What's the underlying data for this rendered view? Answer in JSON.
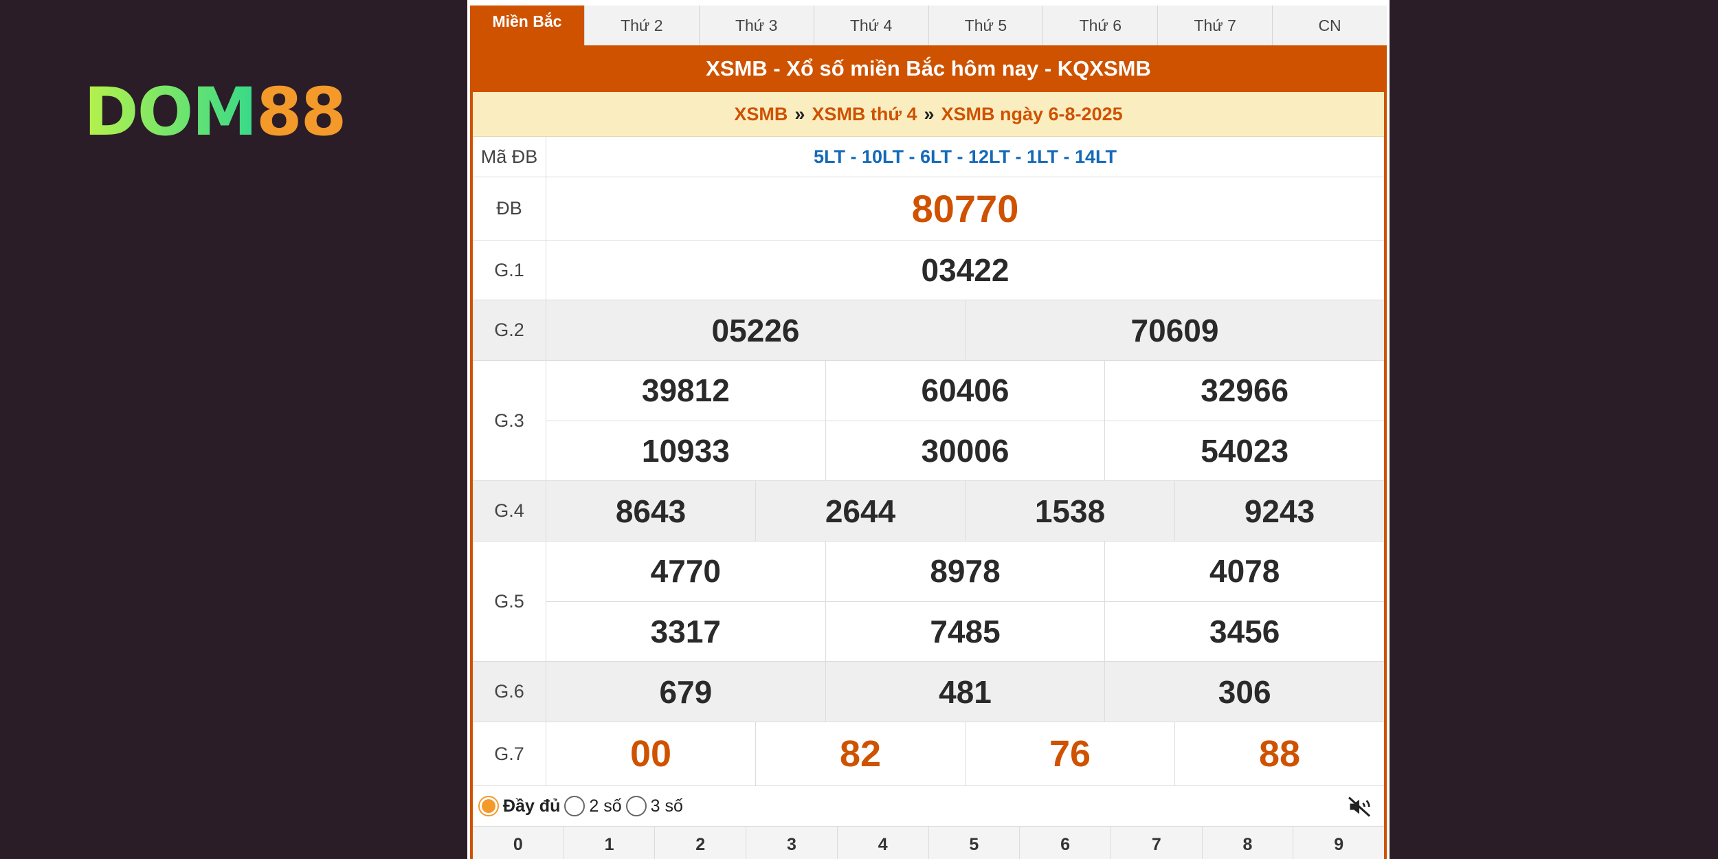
{
  "logo": {
    "part1": "DOM",
    "part2": "88"
  },
  "tabs": [
    "Miền Bắc",
    "Thứ 2",
    "Thứ 3",
    "Thứ 4",
    "Thứ 5",
    "Thứ 6",
    "Thứ 7",
    "CN"
  ],
  "title": "XSMB - Xổ số miền Bắc hôm nay - KQXSMB",
  "breadcrumb": [
    "XSMB",
    "XSMB thứ 4",
    "XSMB ngày 6-8-2025"
  ],
  "breadcrumb_sep": "»",
  "results": {
    "madb_label": "Mã ĐB",
    "madb_value": "5LT - 10LT - 6LT - 12LT - 1LT - 14LT",
    "db_label": "ĐB",
    "db": "80770",
    "g1_label": "G.1",
    "g1": [
      "03422"
    ],
    "g2_label": "G.2",
    "g2": [
      "05226",
      "70609"
    ],
    "g3_label": "G.3",
    "g3": [
      "39812",
      "60406",
      "32966",
      "10933",
      "30006",
      "54023"
    ],
    "g4_label": "G.4",
    "g4": [
      "8643",
      "2644",
      "1538",
      "9243"
    ],
    "g5_label": "G.5",
    "g5": [
      "4770",
      "8978",
      "4078",
      "3317",
      "7485",
      "3456"
    ],
    "g6_label": "G.6",
    "g6": [
      "679",
      "481",
      "306"
    ],
    "g7_label": "G.7",
    "g7": [
      "00",
      "82",
      "76",
      "88"
    ]
  },
  "options": {
    "full": "Đầy đủ",
    "two": "2 số",
    "three": "3 số",
    "selected": "full"
  },
  "mute_icon": "speaker-muted-icon",
  "digits": [
    "0",
    "1",
    "2",
    "3",
    "4",
    "5",
    "6",
    "7",
    "8",
    "9"
  ],
  "colors": {
    "accent": "#cf5200",
    "crumb_bg": "#faeec1",
    "madb": "#1469b8",
    "page_bg": "#2b1d27"
  }
}
